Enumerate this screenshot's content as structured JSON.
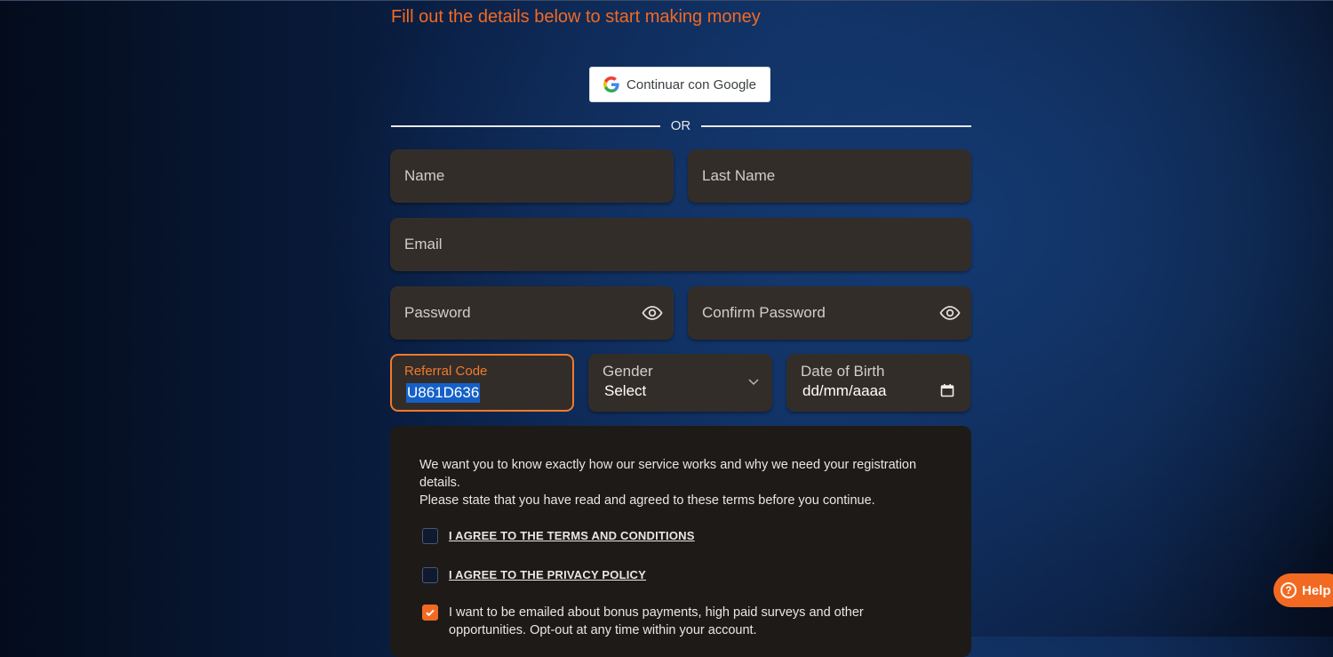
{
  "header": {
    "headline": "Fill out the details below to start making money"
  },
  "google": {
    "label": "Continuar con Google"
  },
  "divider": {
    "label": "OR"
  },
  "form": {
    "name_placeholder": "Name",
    "last_name_placeholder": "Last Name",
    "email_placeholder": "Email",
    "password_placeholder": "Password",
    "confirm_password_placeholder": "Confirm Password",
    "referral_label": "Referral Code",
    "referral_value": "U861D636",
    "gender_label": "Gender",
    "gender_value": "Select",
    "dob_label": "Date of Birth",
    "dob_value": "dd/mm/aaaa"
  },
  "terms": {
    "intro_line1": "We want you to know exactly how our service works and why we need your registration details.",
    "intro_line2": "Please state that you have read and agreed to these terms before you continue.",
    "terms_link": "I AGREE TO THE TERMS AND CONDITIONS",
    "privacy_link": "I AGREE TO THE PRIVACY POLICY",
    "marketing_text": "I want to be emailed about bonus payments, high paid surveys and other opportunities. Opt-out at any time within your account.",
    "terms_checked": false,
    "privacy_checked": false,
    "marketing_checked": true
  },
  "help": {
    "label": "Help"
  },
  "colors": {
    "accent": "#f26a21",
    "field_bg": "#332d2a",
    "panel_bg": "#1e1a18"
  },
  "icons": [
    "google-icon",
    "eye-icon",
    "chevron-down-icon",
    "calendar-icon",
    "checkmark-icon",
    "help-icon"
  ]
}
